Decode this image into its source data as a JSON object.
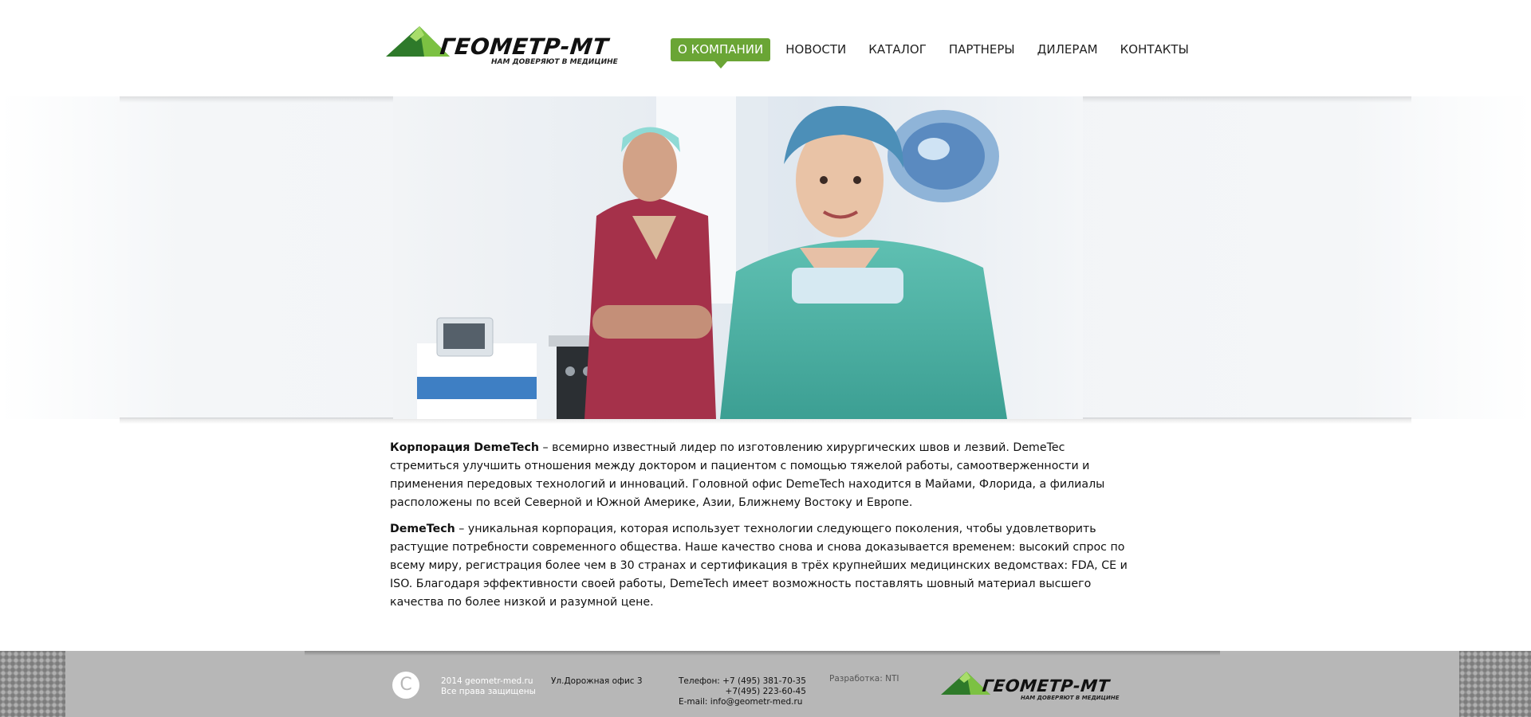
{
  "header": {
    "logo": {
      "name": "ГЕОМЕТР-МТ",
      "tagline": "НАМ ДОВЕРЯЮТ В МЕДИЦИНЕ"
    },
    "nav": [
      {
        "label": "О КОМПАНИИ",
        "active": true
      },
      {
        "label": "НОВОСТИ",
        "active": false
      },
      {
        "label": "КАТАЛОГ",
        "active": false
      },
      {
        "label": "ПАРТНЕРЫ",
        "active": false
      },
      {
        "label": "ДИЛЕРАМ",
        "active": false
      },
      {
        "label": "КОНТАКТЫ",
        "active": false
      }
    ]
  },
  "content": {
    "p1_bold": "Корпорация DemeTech",
    "p1_text": " – всемирно известный лидер по изготовлению хирургических швов и лезвий. DemeTec стремиться улучшить отношения между доктором и пациентом с помощью тяжелой работы, самоотверженности и применения передовых технологий и инноваций. Головной офис DemeTech находится в Майами, Флорида, а филиалы расположены по всей Северной и Южной Америке, Азии, Ближнему Востоку и Европе.",
    "p2_bold": "DemeTech",
    "p2_text": " – уникальная корпорация, которая использует технологии следующего поколения, чтобы удовлетворить растущие потребности современного общества. Наше качество снова и снова доказывается временем: высокий спрос по всему миру, регистрация более чем в 30 странах и сертификация в трёх крупнейших медицинских ведомствах: FDA, CE и ISO. Благодаря эффективности своей работы, DemeTech имеет возможность поставлять шовный материал высшего качества по более низкой и разумной цене."
  },
  "footer": {
    "copyright_symbol": "C",
    "copyright_line1": "2014 geometr-med.ru",
    "copyright_line2": "Все права защищены",
    "address": "Ул.Дорожная  офис 3",
    "phone_line1": "Телефон: +7 (495) 381-70-35",
    "phone_line2": "+7(495) 223-60-45",
    "email": "E-mail: info@geometr-med.ru",
    "developer": "Разработка: NTI"
  },
  "colors": {
    "accent": "#6aa535",
    "footer_bg": "#b7b7b7"
  }
}
